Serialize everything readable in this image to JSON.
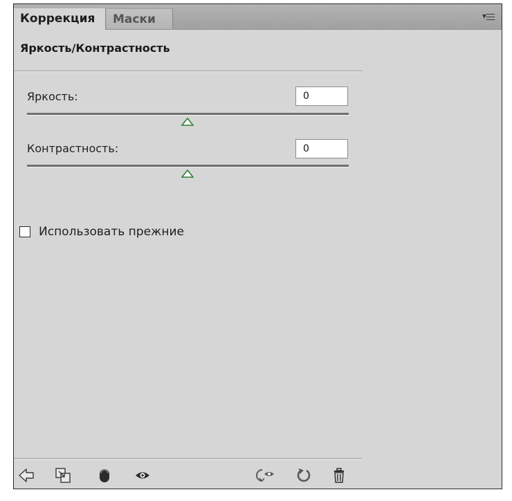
{
  "tabs": [
    {
      "label": "Коррекция",
      "active": true
    },
    {
      "label": "Маски",
      "active": false
    }
  ],
  "adjustment_title": "Яркость/Контрастность",
  "brightness": {
    "label": "Яркость:",
    "value": "0",
    "slider_position": 0.5
  },
  "contrast": {
    "label": "Контрастность:",
    "value": "0",
    "slider_position": 0.5
  },
  "use_legacy": {
    "label": "Использовать прежние",
    "checked": false
  },
  "toolbar": {
    "icons": [
      "back-arrow-icon",
      "clip-to-layer-icon",
      "layer-visibility-mask-icon",
      "eye-icon",
      "view-previous-state-icon",
      "reset-icon",
      "trash-icon"
    ]
  },
  "colors": {
    "panel_bg": "#d6d6d6",
    "slider_thumb_outline": "#2e7d32",
    "tabbar_bg": "#acacac"
  }
}
